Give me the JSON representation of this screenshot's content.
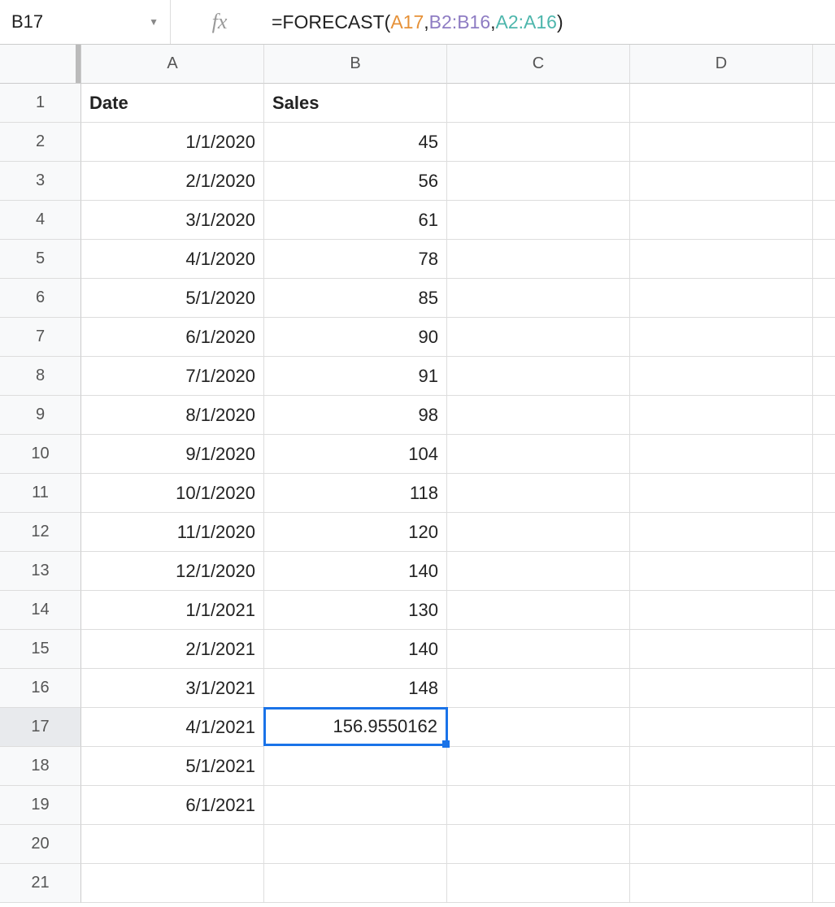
{
  "nameBox": "B17",
  "formula": {
    "prefix": "=FORECAST",
    "openParen": "(",
    "arg1": "A17",
    "comma": ",",
    "space": " ",
    "arg2": "B2:B16",
    "arg3": "A2:A16",
    "closeParen": ")"
  },
  "columns": [
    "A",
    "B",
    "C",
    "D"
  ],
  "rows": [
    "1",
    "2",
    "3",
    "4",
    "5",
    "6",
    "7",
    "8",
    "9",
    "10",
    "11",
    "12",
    "13",
    "14",
    "15",
    "16",
    "17",
    "18",
    "19",
    "20",
    "21"
  ],
  "headers": {
    "A": "Date",
    "B": "Sales"
  },
  "data": [
    {
      "date": "1/1/2020",
      "sales": "45"
    },
    {
      "date": "2/1/2020",
      "sales": "56"
    },
    {
      "date": "3/1/2020",
      "sales": "61"
    },
    {
      "date": "4/1/2020",
      "sales": "78"
    },
    {
      "date": "5/1/2020",
      "sales": "85"
    },
    {
      "date": "6/1/2020",
      "sales": "90"
    },
    {
      "date": "7/1/2020",
      "sales": "91"
    },
    {
      "date": "8/1/2020",
      "sales": "98"
    },
    {
      "date": "9/1/2020",
      "sales": "104"
    },
    {
      "date": "10/1/2020",
      "sales": "118"
    },
    {
      "date": "11/1/2020",
      "sales": "120"
    },
    {
      "date": "12/1/2020",
      "sales": "140"
    },
    {
      "date": "1/1/2021",
      "sales": "130"
    },
    {
      "date": "2/1/2021",
      "sales": "140"
    },
    {
      "date": "3/1/2021",
      "sales": "148"
    },
    {
      "date": "4/1/2021",
      "sales": "156.9550162"
    },
    {
      "date": "5/1/2021",
      "sales": ""
    },
    {
      "date": "6/1/2021",
      "sales": ""
    }
  ],
  "selectedCell": "B17",
  "activeRow": "17"
}
